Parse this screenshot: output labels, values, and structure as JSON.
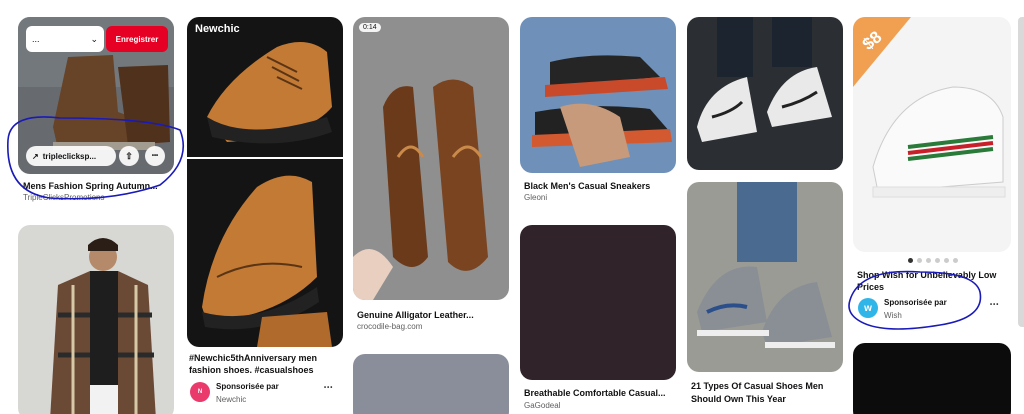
{
  "pins": {
    "p1": {
      "title": "Mens Fashion Spring Autumn...",
      "source": "TripleClicksPromotions",
      "board_value": "...",
      "save_label": "Enregistrer",
      "link_label": "tripleclicksp...",
      "more": "•••"
    },
    "p2": {
      "brand": "Newchic",
      "title_line1": "#Newchic5thAnniversary men",
      "title_line2": "fashion shoes. #casualshoes",
      "sponsored": "Sponsorisée par",
      "advertiser": "Newchic",
      "more": "•••"
    },
    "p3": {
      "duration": "0:14",
      "title": "Genuine Alligator Leather...",
      "source": "crocodile-bag.com"
    },
    "p4": {
      "title": "Black Men's Casual Sneakers",
      "source": "Gleoni"
    },
    "p5": {
      "title": "Breathable Comfortable Casual...",
      "source": "GaGodeal"
    },
    "p6": {
      "title_line1": "21 Types Of Casual Shoes Men",
      "title_line2": "Should Own This Year"
    },
    "p7": {
      "price": "$8",
      "title_line1": "Shop Wish for Unbelievably Low",
      "title_line2": "Prices",
      "sponsored": "Sponsorisée par",
      "advertiser": "Wish",
      "more": "•••"
    }
  },
  "colors": {
    "save": "#e60023",
    "annotation": "#1a1ab8"
  }
}
